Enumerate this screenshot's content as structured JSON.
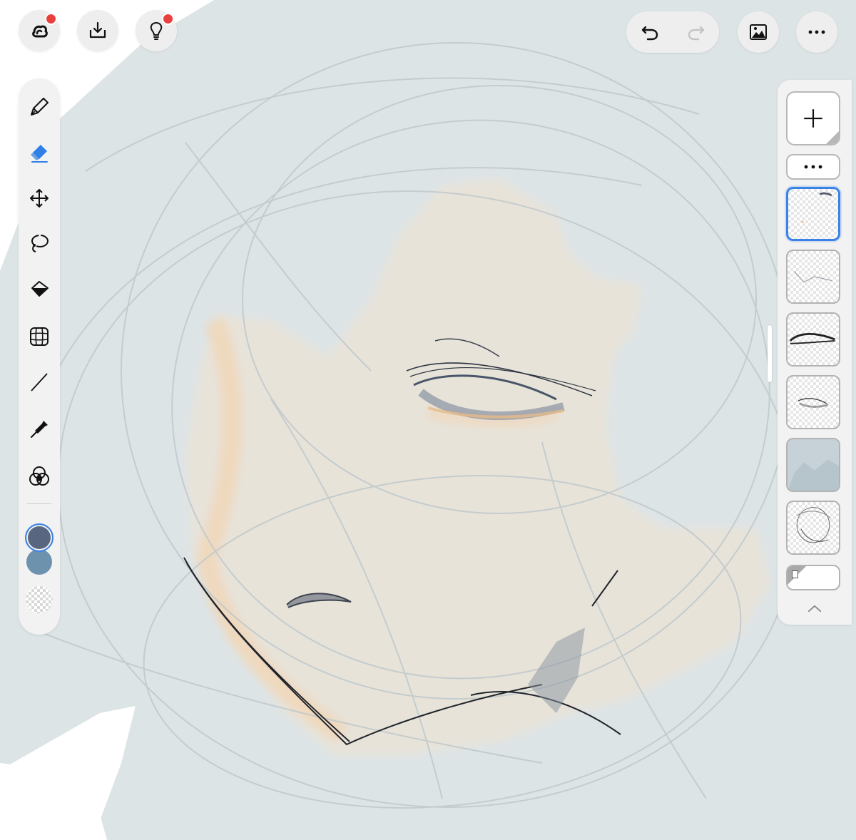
{
  "app": {
    "colors": {
      "canvas_background": "#dde4e6",
      "toolbar_background": "#f2f2f2",
      "selection_accent": "#3a82e6",
      "notification_dot": "#e8413d"
    }
  },
  "top_bar": {
    "left_buttons": [
      {
        "icon": "creative-cloud-icon",
        "has_notification": true
      },
      {
        "icon": "download-tray-icon",
        "has_notification": false
      },
      {
        "icon": "lightbulb-icon",
        "has_notification": true
      }
    ],
    "undo_icon": "undo-icon",
    "redo_icon": "redo-icon",
    "redo_enabled": false,
    "image_icon": "image-icon",
    "more_icon": "more-icon"
  },
  "tools": [
    {
      "id": "brush",
      "icon": "brush-icon",
      "selected": false
    },
    {
      "id": "eraser",
      "icon": "eraser-icon",
      "selected": true
    },
    {
      "id": "move",
      "icon": "move-icon",
      "selected": false
    },
    {
      "id": "lasso",
      "icon": "lasso-icon",
      "selected": false
    },
    {
      "id": "fill",
      "icon": "fill-bucket-icon",
      "selected": false
    },
    {
      "id": "transform",
      "icon": "grid-transform-icon",
      "selected": false
    },
    {
      "id": "line",
      "icon": "line-icon",
      "selected": false
    },
    {
      "id": "eyedropper",
      "icon": "eyedropper-icon",
      "selected": false
    },
    {
      "id": "blend",
      "icon": "color-blend-icon",
      "selected": false
    }
  ],
  "colors": {
    "primary": "#58677f",
    "secondary": "#6d92ad"
  },
  "layers": {
    "add_icon": "plus-icon",
    "menu_icon": "more-icon",
    "collapse_icon": "chevron-up-icon",
    "items": [
      {
        "id": "layer-1",
        "selected": true
      },
      {
        "id": "layer-2",
        "selected": false
      },
      {
        "id": "layer-3",
        "selected": false
      },
      {
        "id": "layer-4",
        "selected": false
      },
      {
        "id": "layer-5",
        "selected": false
      },
      {
        "id": "layer-6",
        "selected": false
      }
    ],
    "background_layer_color": "#ffffff"
  }
}
